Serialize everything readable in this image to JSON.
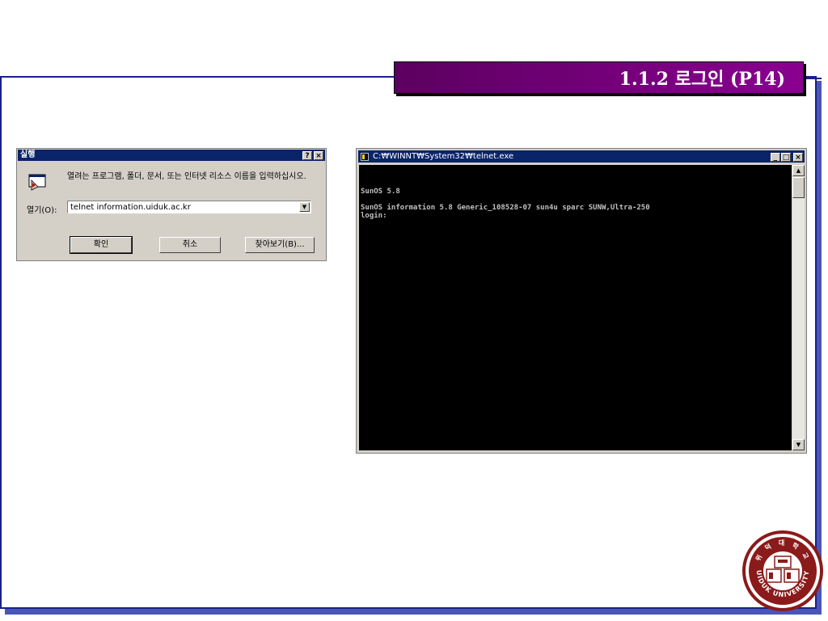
{
  "slide": {
    "title": "1.1.2 로그인 (P14)"
  },
  "run_dialog": {
    "title": "실행",
    "help_button": "?",
    "close_button": "×",
    "description": "열려는 프로그램, 폴더, 문서, 또는 인터넷 리소스 이름을 입력하십시오.",
    "open_label": "열기(O):",
    "open_value": "telnet information.uiduk.ac.kr",
    "ok_button": "확인",
    "cancel_button": "취소",
    "browse_button": "찾아보기(B)..."
  },
  "telnet_window": {
    "title": "C:₩WINNT₩System32₩telnet.exe",
    "minimize": "_",
    "maximize": "□",
    "close": "×",
    "console_lines": [
      "SunOS 5.8",
      "",
      "SunOS information 5.8 Generic_108528-07 sun4u sparc SUNW,Ultra-250",
      "login:"
    ]
  },
  "seal": {
    "text": "UIDUK UNIVERSITY",
    "inner_text": "위 덕 대 학 교"
  },
  "colors": {
    "title_bar": "#7a007e",
    "frame_border": "#1a1f8a",
    "win_title": "#0a246a",
    "seal": "#8b1a1a"
  }
}
